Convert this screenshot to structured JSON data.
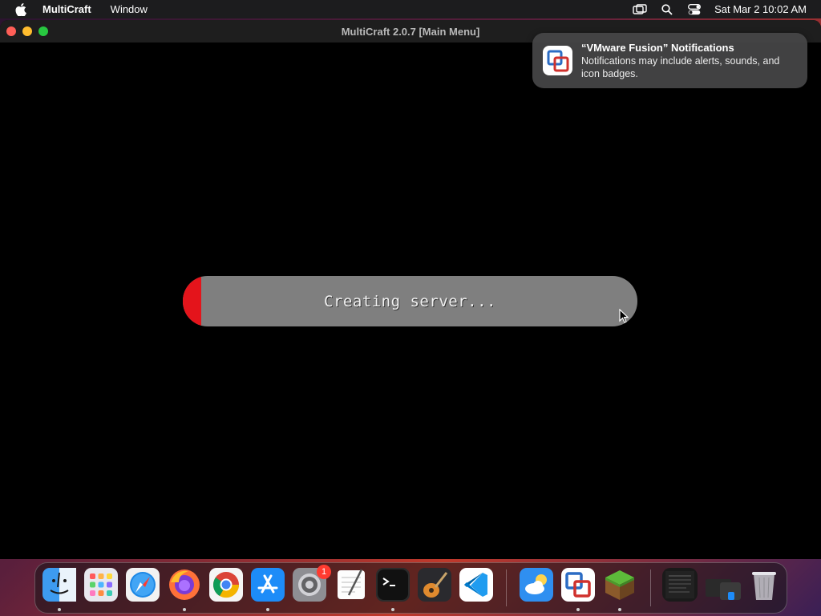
{
  "menubar": {
    "app_name": "MultiCraft",
    "menus": [
      "Window"
    ],
    "clock": "Sat Mar 2  10:02 AM"
  },
  "window": {
    "title": "MultiCraft 2.0.7 [Main Menu]"
  },
  "progress": {
    "label": "Creating server...",
    "fraction": 0.04,
    "fill_color": "#e4141b"
  },
  "notification": {
    "title": "“VMware Fusion” Notifications",
    "body": "Notifications may include alerts, sounds, and icon badges."
  },
  "dock": {
    "items": [
      {
        "name": "finder",
        "running": true
      },
      {
        "name": "launchpad",
        "running": false
      },
      {
        "name": "safari",
        "running": false
      },
      {
        "name": "firefox",
        "running": true
      },
      {
        "name": "chrome",
        "running": false
      },
      {
        "name": "app-store",
        "running": true
      },
      {
        "name": "system-settings",
        "running": false,
        "badge": "1"
      },
      {
        "name": "textedit",
        "running": false
      },
      {
        "name": "terminal",
        "running": true
      },
      {
        "name": "garageband",
        "running": false
      },
      {
        "name": "vscode",
        "running": false
      },
      {
        "name": "weather",
        "running": false
      },
      {
        "name": "vmware-fusion",
        "running": true
      },
      {
        "name": "multicraft",
        "running": true
      }
    ]
  }
}
